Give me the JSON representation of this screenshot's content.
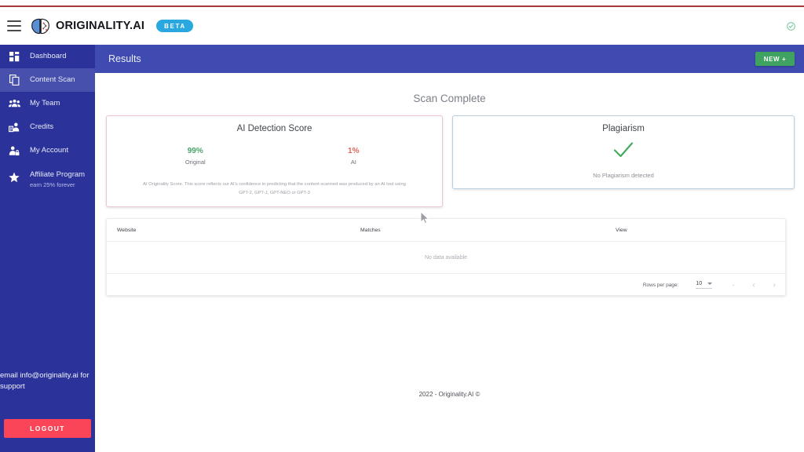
{
  "brand": {
    "name": "ORIGINALITY.AI",
    "badge": "BETA",
    "logo_icon": "brain-icon",
    "menu_icon": "hamburger-menu-icon",
    "status_icon": "check-circle-icon"
  },
  "sidebar": {
    "items": [
      {
        "label": "Dashboard",
        "icon": "grid-dashboard-icon",
        "active": false
      },
      {
        "label": "Content Scan",
        "icon": "copy-documents-icon",
        "active": true
      },
      {
        "label": "My Team",
        "icon": "people-group-icon",
        "active": false
      },
      {
        "label": "Credits",
        "icon": "person-money-icon",
        "active": false
      },
      {
        "label": "My Account",
        "icon": "person-lock-icon",
        "active": false
      },
      {
        "label": "Affiliate Program",
        "sublabel": "earn 25% forever",
        "icon": "star-icon",
        "active": false
      }
    ],
    "support_text": "email info@originality.ai for support",
    "logout_label": "LOGOUT"
  },
  "header": {
    "title": "Results",
    "new_button": "NEW +"
  },
  "main": {
    "status_heading": "Scan Complete",
    "ai_card": {
      "title": "AI Detection Score",
      "original_value": "99%",
      "original_label": "Original",
      "ai_value": "1%",
      "ai_label": "AI",
      "disclaimer_line1": "AI Originality Score. This score reflects our AI's confidence in predicting that the content scanned was produced by an AI tool using",
      "disclaimer_line2": "GPT-2, GPT-J, GPT-NEO or GPT-3"
    },
    "plagiarism_card": {
      "title": "Plagiarism",
      "icon": "green-checkmark-icon",
      "message": "No Plagiarism detected"
    },
    "table": {
      "columns": [
        "Website",
        "Matches",
        "View"
      ],
      "empty_message": "No data available",
      "pagination": {
        "rows_per_page_label": "Rows per page:",
        "rows_per_page_value": "10",
        "range_text": "-",
        "prev_icon": "chevron-left-icon",
        "next_icon": "chevron-right-icon"
      }
    },
    "footer": "2022 - Originality.AI ©"
  },
  "colors": {
    "sidebar_bg": "#2b339b",
    "header_bg": "#3f4bb0",
    "accent_green": "#3fa260",
    "logout_red": "#fa4559",
    "beta_blue": "#29a8e0",
    "original_green": "#4aa368",
    "ai_red": "#e0685f",
    "ai_card_border": "#edc6ce",
    "plag_card_border": "#b8cfe0"
  }
}
